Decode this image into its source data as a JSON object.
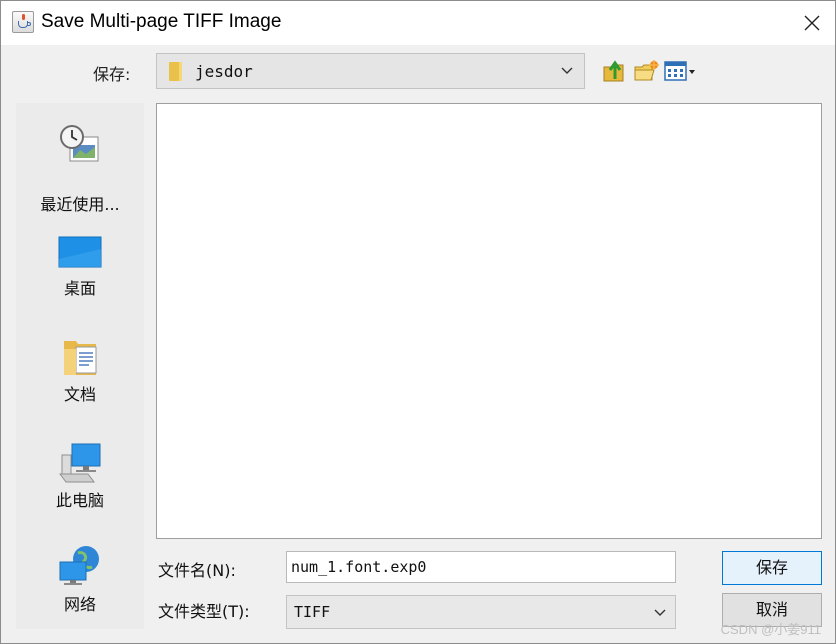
{
  "window": {
    "title": "Save Multi-page TIFF Image",
    "app_icon": "java-cup-icon",
    "close_icon": "close-icon"
  },
  "save_in": {
    "label": "保存:",
    "value": "jesdor",
    "folder_icon": "folder-icon"
  },
  "toolbar": {
    "up_icon": "up-one-level-icon",
    "new_folder_icon": "new-folder-icon",
    "view_menu_icon": "view-menu-icon"
  },
  "places": [
    {
      "label": "最近使用...",
      "icon": "recent-items-icon"
    },
    {
      "label": "桌面",
      "icon": "desktop-icon"
    },
    {
      "label": "文档",
      "icon": "documents-icon"
    },
    {
      "label": "此电脑",
      "icon": "computer-icon"
    },
    {
      "label": "网络",
      "icon": "network-icon"
    }
  ],
  "file_name": {
    "label": "文件名(N):",
    "value": "num_1.font.exp0"
  },
  "file_type": {
    "label": "文件类型(T):",
    "value": "TIFF"
  },
  "buttons": {
    "save_label": "保存",
    "cancel_label": "取消"
  },
  "watermark": "CSDN @小姜911",
  "colors": {
    "accent_border": "#0078d7",
    "save_button_bg": "#e5f1fb",
    "dialog_bg": "#f0f0f0"
  }
}
